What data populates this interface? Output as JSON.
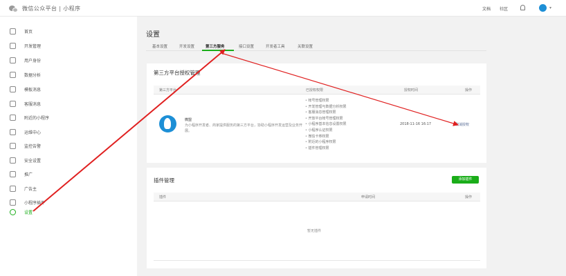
{
  "header": {
    "logo_text": "微信公众平台 | 小程序",
    "nav": [
      "文档",
      "社区"
    ]
  },
  "sidebar": {
    "items": [
      {
        "label": "首页",
        "icon": "home-icon"
      },
      {
        "label": "开发管理",
        "icon": "code-icon"
      },
      {
        "label": "用户身份",
        "icon": "user-icon"
      },
      {
        "label": "数据分析",
        "icon": "chart-icon"
      },
      {
        "label": "模板消息",
        "icon": "message-icon"
      },
      {
        "label": "客服消息",
        "icon": "chat-icon"
      },
      {
        "label": "附近的小程序",
        "icon": "location-icon"
      },
      {
        "label": "运维中心",
        "icon": "wrench-icon"
      },
      {
        "label": "监控告警",
        "icon": "monitor-icon"
      },
      {
        "label": "安全设置",
        "icon": "shield-icon"
      },
      {
        "label": "推广",
        "icon": "promote-icon"
      },
      {
        "label": "广告主",
        "icon": "ad-icon"
      },
      {
        "label": "小程序插件",
        "icon": "plugin-icon"
      },
      {
        "label": "设置",
        "icon": "gear-icon"
      }
    ],
    "active_index": 13
  },
  "main": {
    "title": "设置",
    "tabs": [
      "基本设置",
      "开发设置",
      "第三方服务",
      "接口设置",
      "开发者工具",
      "关联设置"
    ],
    "active_tab": 2,
    "third_party": {
      "title": "第三方平台授权管理",
      "columns": [
        "第三方平台",
        "已授权权限",
        "授权时间",
        "操作"
      ],
      "row": {
        "name": "微盟",
        "description": "为小程序开发者、商家提供服务的第三方平台，协助小程序开发运营及业务开展。",
        "permissions": [
          "帐号管理权限",
          "开发管理与数据分析权限",
          "客服消息管理权限",
          "开放平台帐号管理权限",
          "小程序基本信息设置权限",
          "小程序认证权限",
          "微信卡券权限",
          "附近的小程序权限",
          "插件管理权限"
        ],
        "time": "2018-11-16 16:17",
        "action": "取消授权"
      }
    },
    "plugins": {
      "title": "插件管理",
      "add_label": "添加插件",
      "columns": [
        "插件",
        "申请时间",
        "操作"
      ],
      "empty_text": "暂无插件"
    }
  },
  "colors": {
    "accent_green": "#1aad19",
    "link_blue": "#576b95",
    "annotation_red": "#e02020",
    "avatar_blue": "#1d8fd6"
  }
}
